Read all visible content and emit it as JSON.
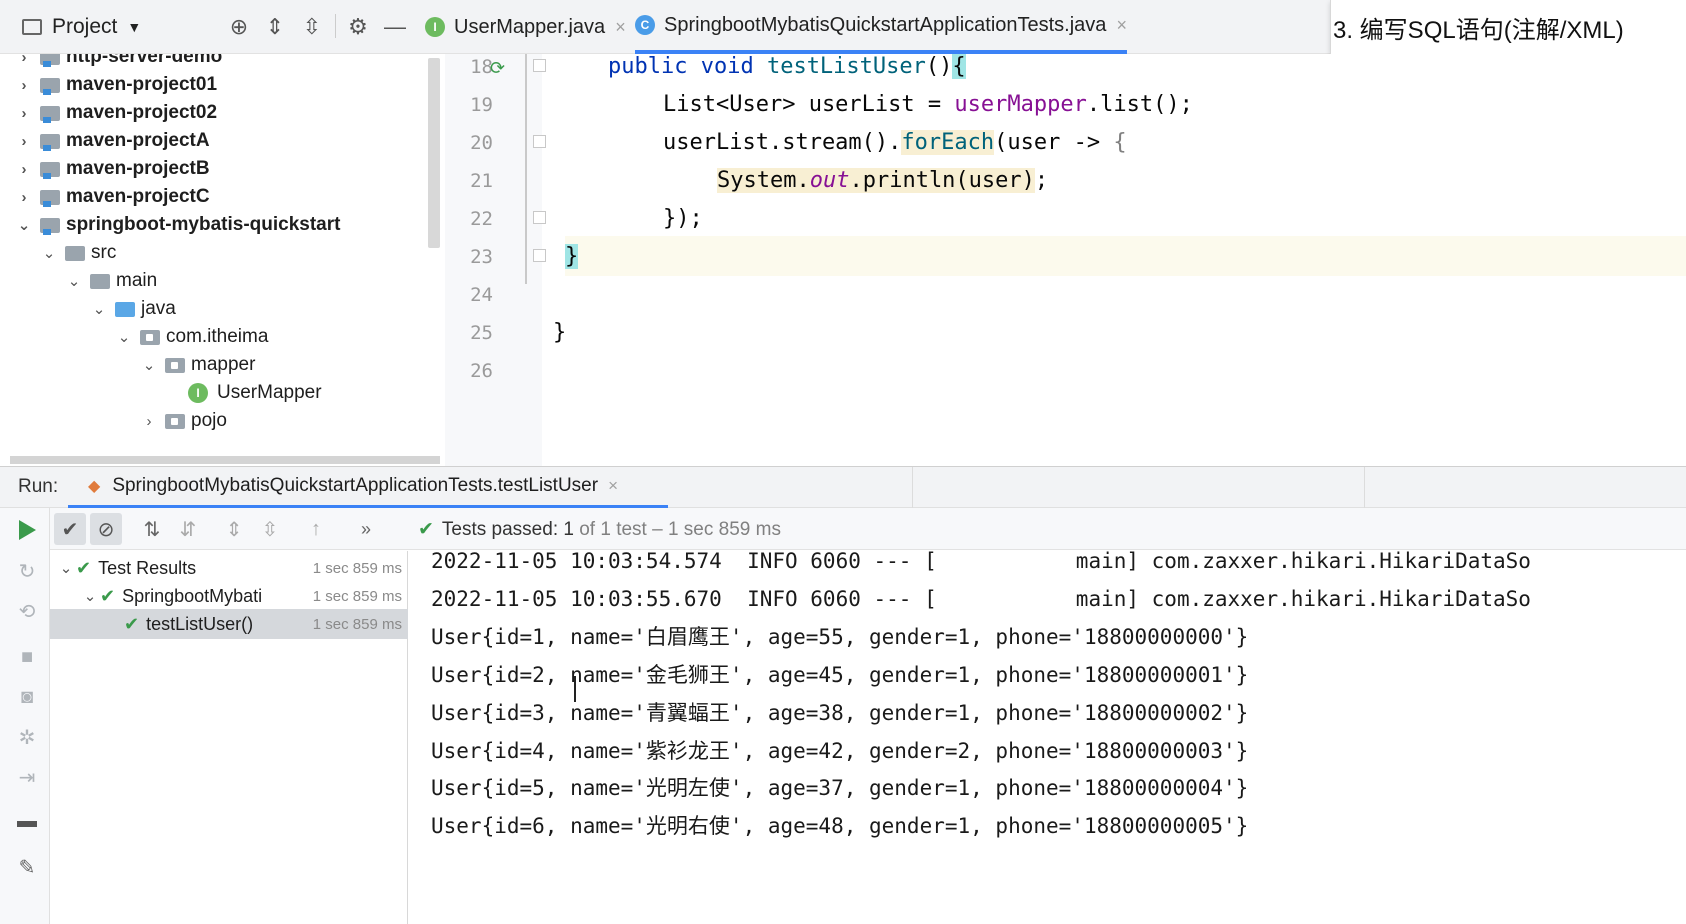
{
  "project_panel": {
    "title": "Project",
    "header_icons": [
      "target-icon",
      "expand-all-icon",
      "collapse-all-icon",
      "gear-icon",
      "minimize-icon"
    ]
  },
  "tabs": [
    {
      "label": "UserMapper.java",
      "icon": "interface-icon",
      "icon_glyph": "I",
      "active": false
    },
    {
      "label": "SpringbootMybatisQuickstartApplicationTests.java",
      "icon": "class-icon",
      "icon_glyph": "C",
      "active": true
    }
  ],
  "tab_close_glyph": "×",
  "note": {
    "text": "3.   编写SQL语句(注解/XML)"
  },
  "tree": [
    {
      "label": "http-server-demo",
      "bold": true,
      "arrow": "›",
      "kind": "module",
      "depth": 0
    },
    {
      "label": "maven-project01",
      "bold": true,
      "arrow": "›",
      "kind": "module",
      "depth": 0
    },
    {
      "label": "maven-project02",
      "bold": true,
      "arrow": "›",
      "kind": "module",
      "depth": 0
    },
    {
      "label": "maven-projectA",
      "bold": true,
      "arrow": "›",
      "kind": "module",
      "depth": 0
    },
    {
      "label": "maven-projectB",
      "bold": true,
      "arrow": "›",
      "kind": "module",
      "depth": 0
    },
    {
      "label": "maven-projectC",
      "bold": true,
      "arrow": "›",
      "kind": "module",
      "depth": 0
    },
    {
      "label": "springboot-mybatis-quickstart",
      "bold": true,
      "arrow": "⌄",
      "kind": "module",
      "depth": 0
    },
    {
      "label": "src",
      "bold": false,
      "arrow": "⌄",
      "kind": "folder",
      "depth": 1
    },
    {
      "label": "main",
      "bold": false,
      "arrow": "⌄",
      "kind": "folder",
      "depth": 2
    },
    {
      "label": "java",
      "bold": false,
      "arrow": "⌄",
      "kind": "source-folder",
      "depth": 3
    },
    {
      "label": "com.itheima",
      "bold": false,
      "arrow": "⌄",
      "kind": "package",
      "depth": 4
    },
    {
      "label": "mapper",
      "bold": false,
      "arrow": "⌄",
      "kind": "package",
      "depth": 5
    },
    {
      "label": "UserMapper",
      "bold": false,
      "arrow": "",
      "kind": "interface",
      "depth": 6
    },
    {
      "label": "pojo",
      "bold": false,
      "arrow": "›",
      "kind": "package",
      "depth": 5
    }
  ],
  "editor": {
    "line_numbers": [
      "18",
      "19",
      "20",
      "21",
      "22",
      "23",
      "24",
      "25",
      "26"
    ],
    "code": {
      "l18_public": "public ",
      "l18_void": "void ",
      "l18_method": "testListUser",
      "l18_parens": "()",
      "l18_brace": "{",
      "l19_type": "List<User> userList = ",
      "l19_field": "userMapper",
      "l19_call": ".list();",
      "l20_a": "userList.stream().",
      "l20_foreach": "forEach",
      "l20_b": "(user -> ",
      "l20_brace": "{",
      "l21_system": "System.",
      "l21_out": "out",
      "l21_call": ".println(user)",
      "l21_semi": ";",
      "l22_close": "});",
      "l23_brace": "}",
      "l25_brace": "}"
    }
  },
  "run": {
    "label": "Run:",
    "tab_label": "SpringbootMybatisQuickstartApplicationTests.testListUser",
    "status_passed": "Tests passed: 1",
    "status_detail": " of 1 test – 1 sec 859 ms",
    "toolbar_more": "»"
  },
  "results": [
    {
      "label": "Test Results",
      "time": "1 sec 859 ms",
      "arrow": "⌄",
      "selected": false
    },
    {
      "label": "SpringbootMybati",
      "time": "1 sec 859 ms",
      "arrow": "⌄",
      "selected": false
    },
    {
      "label": "testListUser()",
      "time": "1 sec 859 ms",
      "arrow": "",
      "selected": true
    }
  ],
  "console_lines": [
    "2022-11-05 10:03:54.574  INFO 6060 --- [           main] com.zaxxer.hikari.HikariDataSo",
    "2022-11-05 10:03:55.670  INFO 6060 --- [           main] com.zaxxer.hikari.HikariDataSo",
    "User{id=1, name='白眉鹰王', age=55, gender=1, phone='18800000000'}",
    "User{id=2, name='金毛狮王', age=45, gender=1, phone='18800000001'}",
    "User{id=3, name='青翼蝠王', age=38, gender=1, phone='18800000002'}",
    "User{id=4, name='紫衫龙王', age=42, gender=2, phone='18800000003'}",
    "User{id=5, name='光明左使', age=37, gender=1, phone='18800000004'}",
    "User{id=6, name='光明右使', age=48, gender=1, phone='18800000005'}"
  ],
  "colors": {
    "keyword": "#0033b3",
    "method": "#00627a",
    "field": "#871094",
    "pass_green": "#3a9a4b",
    "tab_underline": "#3b82f6",
    "brace_highlight": "#9fe5e5"
  }
}
